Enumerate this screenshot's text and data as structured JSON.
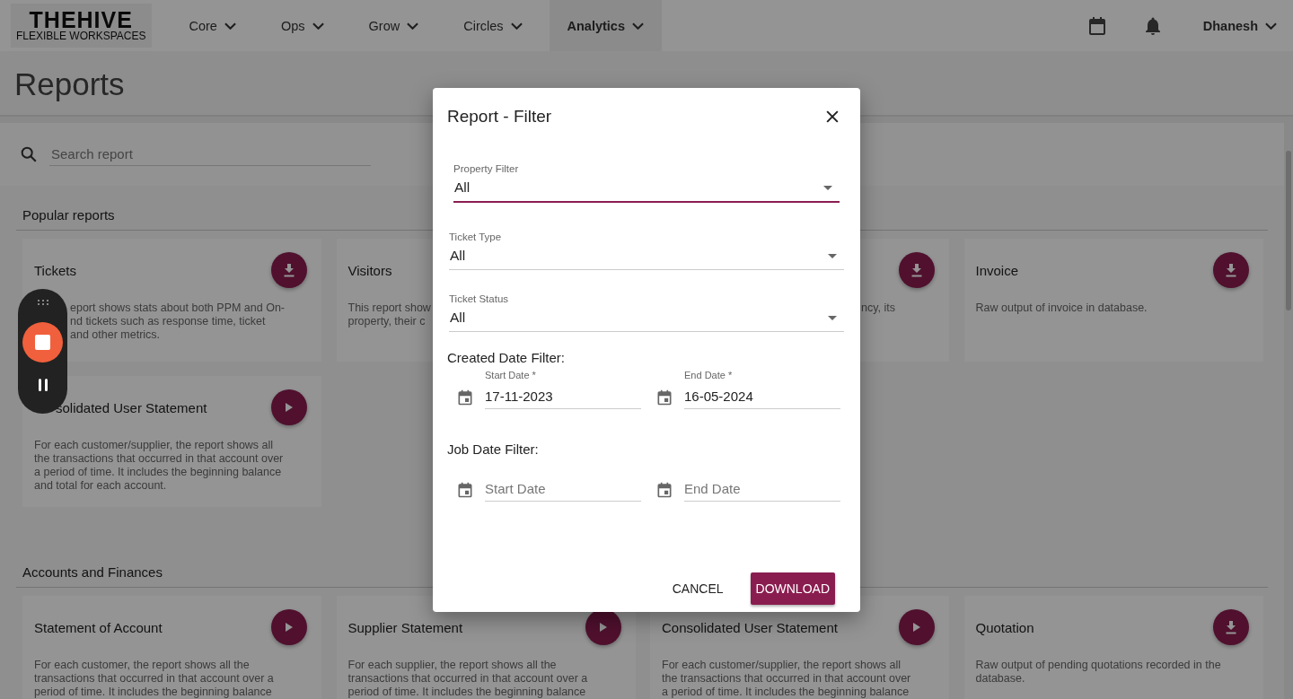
{
  "nav": {
    "logo": {
      "title": "THEHIVE",
      "subtitle": "FLEXIBLE WORKSPACES"
    },
    "items": [
      {
        "label": "Core",
        "selected": false
      },
      {
        "label": "Ops",
        "selected": false
      },
      {
        "label": "Grow",
        "selected": false
      },
      {
        "label": "Circles",
        "selected": false
      },
      {
        "label": "Analytics",
        "selected": true
      }
    ],
    "user": "Dhanesh"
  },
  "page_title": "Reports",
  "search": {
    "placeholder": "Search report"
  },
  "sections": [
    {
      "title": "Popular reports",
      "cards": [
        {
          "title": "Tickets",
          "kind": "download",
          "covered_description": true,
          "description": [
            "eport shows stats about both PPM and On-",
            "nd tickets such as response time, ticket",
            "and other metrics."
          ]
        },
        {
          "title": "Visitors",
          "kind": "none",
          "description": [
            "This report show",
            "property, their c"
          ]
        },
        {
          "kind": "download",
          "covered_description": true,
          "description": [
            "ncy, its"
          ]
        },
        {
          "title": "Invoice",
          "kind": "download",
          "description": [
            "Raw output of invoice in database."
          ]
        },
        {
          "title": "solidated User Statement",
          "kind": "play",
          "covered_title": true,
          "description": [
            "For each customer/supplier, the report shows all",
            "the transactions that occurred in that account over",
            "a period of time. It includes the beginning balance",
            "and total for each account."
          ]
        }
      ]
    },
    {
      "title": "Accounts and Finances",
      "cards": [
        {
          "title": "Statement of Account",
          "kind": "play",
          "description": [
            "For each customer, the report shows all the",
            "transactions that occurred in that account over a",
            "period of time. It includes the beginning balance"
          ]
        },
        {
          "title": "Supplier Statement",
          "kind": "play",
          "description": [
            "For each supplier, the report shows all the",
            "transactions that occurred in that account over a",
            "period of time. It includes the beginning balance"
          ]
        },
        {
          "title": "Consolidated User Statement",
          "kind": "play",
          "description": [
            "For each customer/supplier, the report shows all",
            "the transactions that occurred in that account over",
            "a period of time. It includes the beginning balance"
          ]
        },
        {
          "title": "Quotation",
          "kind": "download",
          "description": [
            "Raw output of pending quotations recorded in the",
            "database."
          ]
        }
      ]
    }
  ],
  "dialog": {
    "title": "Report - Filter",
    "selects": [
      {
        "label": "Property Filter",
        "value": "All",
        "focused": true
      },
      {
        "label": "Ticket Type",
        "value": "All",
        "focused": false
      },
      {
        "label": "Ticket Status",
        "value": "All",
        "focused": false
      }
    ],
    "date_groups": [
      {
        "title": "Created Date Filter:",
        "fields": [
          {
            "label": "Start Date *",
            "value": "17-11-2023"
          },
          {
            "label": "End Date *",
            "value": "16-05-2024"
          }
        ]
      },
      {
        "title": "Job Date Filter:",
        "fields": [
          {
            "placeholder": "Start Date"
          },
          {
            "placeholder": "End Date"
          }
        ]
      }
    ],
    "buttons": [
      {
        "label": "CANCEL",
        "kind": "text"
      },
      {
        "label": "DOWNLOAD",
        "kind": "primary"
      }
    ]
  }
}
